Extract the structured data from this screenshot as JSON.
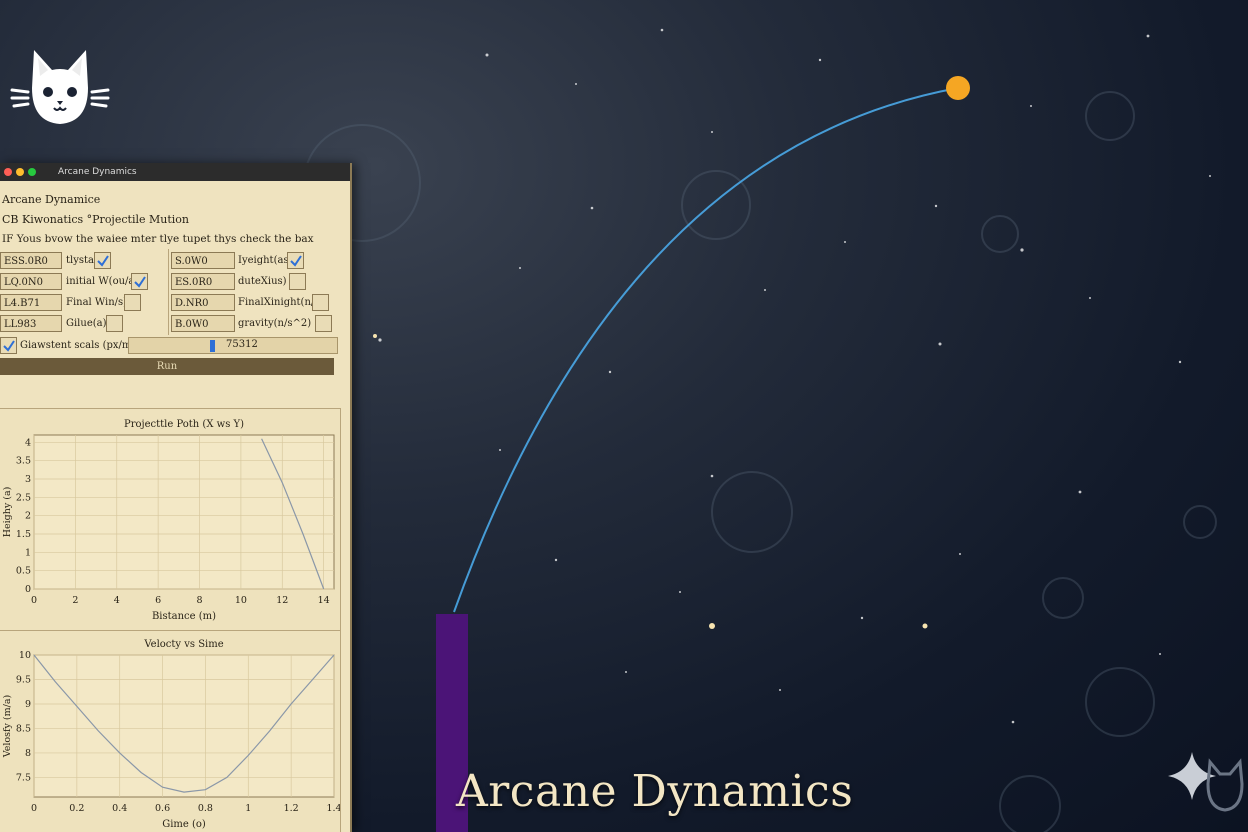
{
  "scene": {
    "heading": "Arcane Dynamics"
  },
  "window": {
    "titlebar": "Arcane Dynamics",
    "app_title": "Arcane Dynamice",
    "section": "CB Kiwonatics °Projectile Mution",
    "instruction": "IF Yous bvow the waiee mter tlye tupet thys check the bax",
    "left_fields": [
      {
        "value": "ESS.0R0",
        "label": "tlysta",
        "checked": true
      },
      {
        "value": "LQ.0N0",
        "label": "initial W(ou/a)",
        "checked": true
      },
      {
        "value": "L4.B71",
        "label": "Final Win/s)",
        "checked": false
      },
      {
        "value": "LL983",
        "label": "Gilue(a)",
        "checked": false
      }
    ],
    "right_fields": [
      {
        "value": "S.0W0",
        "label": "Iyeight(as)",
        "checked": true
      },
      {
        "value": "ES.0R0",
        "label": "duteXius)",
        "checked": false
      },
      {
        "value": "D.NR0",
        "label": "FinalXinight(n/s)",
        "checked": false
      },
      {
        "value": "B.0W0",
        "label": "gravity(n/s^2)",
        "checked": false
      }
    ],
    "scale": {
      "label": "Giawstent scals (px/m)",
      "checked": true,
      "value": "75312"
    },
    "run_label": "Run"
  },
  "chart_data": [
    {
      "type": "line",
      "title": "Projecttle Poth (X ws Y)",
      "xlabel": "Bistance (m)",
      "ylabel": "Heighy (a)",
      "x_ticks": [
        "0",
        "2",
        "4",
        "6",
        "8",
        "10",
        "12",
        "14"
      ],
      "y_ticks": [
        "0",
        "0.5",
        "1",
        "1.5",
        "2",
        "2.5",
        "3",
        "3.5",
        "4"
      ],
      "xlim": [
        0,
        14.5
      ],
      "ylim": [
        0,
        4.2
      ],
      "series": [
        {
          "x": [
            11,
            12,
            13,
            14
          ],
          "y": [
            4.1,
            2.9,
            1.5,
            0
          ]
        }
      ]
    },
    {
      "type": "line",
      "title": "Velocty vs Sime",
      "xlabel": "Gime (o)",
      "ylabel": "Velosfy (m/a)",
      "x_ticks": [
        "0",
        "0.2",
        "0.4",
        "0.6",
        "0.8",
        "1",
        "1.2",
        "1.4"
      ],
      "y_ticks": [
        "7.5",
        "8",
        "8.5",
        "9",
        "9.5",
        "10"
      ],
      "xlim": [
        0,
        1.4
      ],
      "ylim": [
        7.1,
        10
      ],
      "series": [
        {
          "x": [
            0,
            0.1,
            0.2,
            0.3,
            0.4,
            0.5,
            0.6,
            0.7,
            0.8,
            0.9,
            1.0,
            1.1,
            1.2,
            1.3,
            1.4
          ],
          "y": [
            10,
            9.45,
            8.95,
            8.45,
            8.0,
            7.6,
            7.3,
            7.2,
            7.25,
            7.5,
            7.95,
            8.45,
            9.0,
            9.5,
            10
          ]
        }
      ]
    }
  ]
}
